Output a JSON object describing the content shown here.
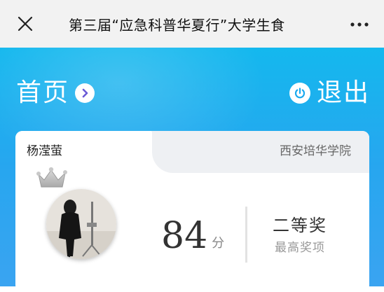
{
  "topbar": {
    "title": "第三届“应急科普华夏行”大学生食",
    "close_icon": "close-icon",
    "more_icon": "more-dots-icon"
  },
  "hero": {
    "home_label": "首页",
    "home_icon": "chevron-right-icon",
    "logout_label": "退出",
    "logout_icon": "power-icon"
  },
  "card": {
    "user_name": "杨滢萤",
    "school": "西安培华学院",
    "crown_icon": "crown-icon",
    "score": "84",
    "score_unit": "分",
    "award": "二等奖",
    "award_caption": "最高奖项"
  },
  "colors": {
    "hero_blue": "#1fb0ef",
    "chevron_purple": "#6b5bd6",
    "power_blue": "#1aa9ee"
  }
}
